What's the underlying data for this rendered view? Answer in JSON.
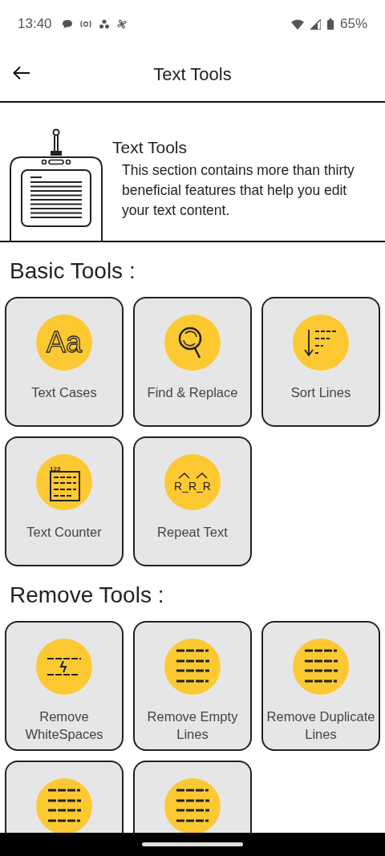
{
  "status_bar": {
    "time": "13:40",
    "battery": "65%"
  },
  "app_bar": {
    "title": "Text Tools"
  },
  "intro": {
    "title": "Text Tools",
    "description": "This section contains more than thirty beneficial features that help you edit your text content."
  },
  "sections": [
    {
      "title": "Basic Tools :",
      "tools": [
        {
          "label": "Text Cases",
          "kind": "cases",
          "icon_text": "Aa"
        },
        {
          "label": "Find & Replace",
          "kind": "search"
        },
        {
          "label": "Sort Lines",
          "kind": "sort"
        },
        {
          "label": "Text Counter",
          "kind": "counter",
          "icon_text": "123"
        },
        {
          "label": "Repeat Text",
          "kind": "repeat",
          "icon_text": "R_R_R"
        }
      ]
    },
    {
      "title": "Remove Tools :",
      "tools": [
        {
          "label": "Remove WhiteSpaces",
          "kind": "whitespace"
        },
        {
          "label": "Remove Empty Lines",
          "kind": "lines"
        },
        {
          "label": "Remove Duplicate Lines",
          "kind": "lines"
        },
        {
          "kind": "lines"
        },
        {
          "kind": "lines"
        }
      ]
    }
  ]
}
